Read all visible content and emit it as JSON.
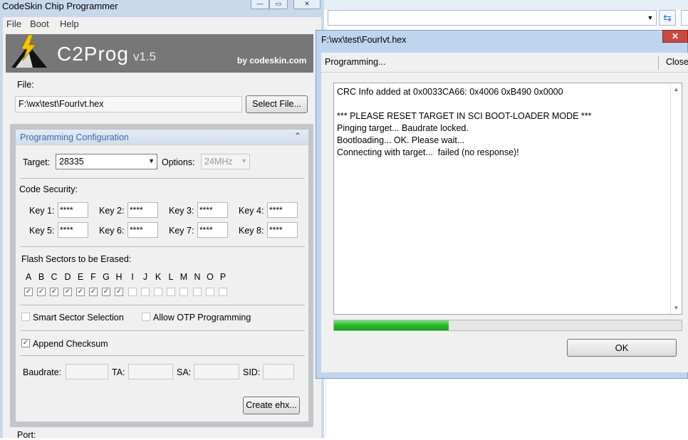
{
  "window": {
    "title": "CodeSkin Chip Programmer"
  },
  "menu": [
    "File",
    "Boot",
    "Help"
  ],
  "banner": {
    "app_name": "C2Prog",
    "version": "v1.5",
    "byline": "by codeskin.com"
  },
  "file": {
    "label": "File:",
    "path": "F:\\wx\\test\\FourIvt.hex",
    "select_button": "Select File..."
  },
  "config": {
    "title": "Programming Configuration",
    "target_label": "Target:",
    "target_value": "28335",
    "options_label": "Options:",
    "options_value": "24MHz",
    "code_security_label": "Code Security:",
    "keys": [
      {
        "label": "Key 1:",
        "value": "****"
      },
      {
        "label": "Key 2:",
        "value": "****"
      },
      {
        "label": "Key 3:",
        "value": "****"
      },
      {
        "label": "Key 4:",
        "value": "****"
      },
      {
        "label": "Key 5:",
        "value": "****"
      },
      {
        "label": "Key 6:",
        "value": "****"
      },
      {
        "label": "Key 7:",
        "value": "****"
      },
      {
        "label": "Key 8:",
        "value": "****"
      }
    ],
    "sectors_label": "Flash Sectors to be Erased:",
    "sectors": [
      {
        "letter": "A",
        "checked": true
      },
      {
        "letter": "B",
        "checked": true
      },
      {
        "letter": "C",
        "checked": true
      },
      {
        "letter": "D",
        "checked": true
      },
      {
        "letter": "E",
        "checked": true
      },
      {
        "letter": "F",
        "checked": true
      },
      {
        "letter": "G",
        "checked": true
      },
      {
        "letter": "H",
        "checked": true
      },
      {
        "letter": "I",
        "checked": false
      },
      {
        "letter": "J",
        "checked": false
      },
      {
        "letter": "K",
        "checked": false
      },
      {
        "letter": "L",
        "checked": false
      },
      {
        "letter": "M",
        "checked": false
      },
      {
        "letter": "N",
        "checked": false
      },
      {
        "letter": "O",
        "checked": false
      },
      {
        "letter": "P",
        "checked": false
      }
    ],
    "smart_sector_label": "Smart Sector Selection",
    "smart_sector_checked": false,
    "otp_label": "Allow OTP Programming",
    "otp_checked": false,
    "append_checksum_label": "Append Checksum",
    "append_checksum_checked": true,
    "baudrate_label": "Baudrate:",
    "ta_label": "TA:",
    "sa_label": "SA:",
    "sid_label": "SID:",
    "create_button": "Create ehx...",
    "port_label": "Port:"
  },
  "dialog": {
    "title": "F:\\wx\\test\\FourIvt.hex",
    "status": "Programming...",
    "close_label": "Close",
    "log_text": "CRC Info added at 0x0033CA66: 0x4006 0xB490 0x0000\n\n*** PLEASE RESET TARGET IN SCI BOOT-LOADER MODE ***\nPinging target... Baudrate locked.\nBootloading... OK. Please wait...\nConnecting with target...  failed (no response)!",
    "progress_fraction": 0.33,
    "ok_button": "OK"
  },
  "colors": {
    "accent_blue": "#3c6bb0",
    "progress_green": "#22b322",
    "close_red": "#c84a40"
  },
  "icons": {
    "logo": "lightning-pyramid-logo",
    "refresh": "refresh-icon",
    "collapse": "chevron-up-double-icon"
  }
}
